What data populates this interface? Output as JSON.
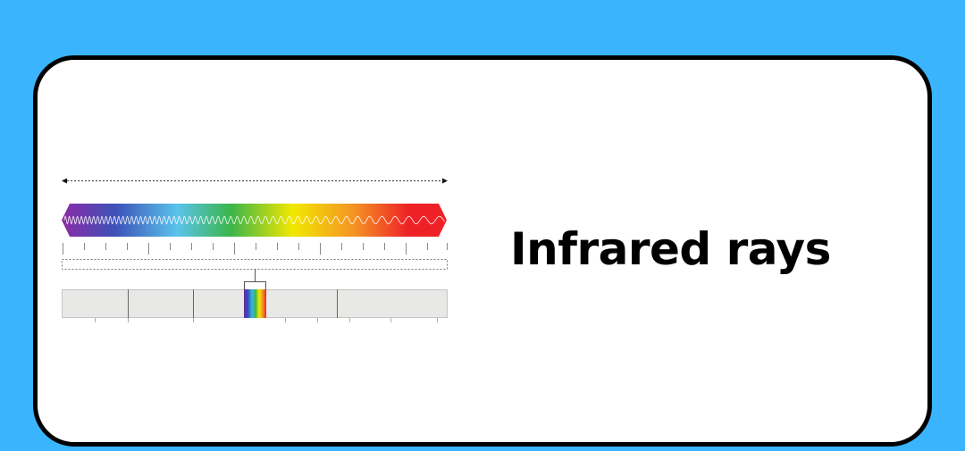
{
  "heading": "Infrared rays",
  "colors": {
    "background": "#3bb4fe",
    "card": "#ffffff",
    "card_border": "#000000",
    "scale_segment": "#e8e8e6",
    "spectrum_stops": [
      "#8b2ba6",
      "#3d52b8",
      "#5ac3ec",
      "#3cb54a",
      "#f2e800",
      "#f49324",
      "#ee2226",
      "#ee2226"
    ]
  },
  "icons": {
    "range_arrow": "double-headed-arrow-icon",
    "wave": "sine-wave-icon"
  }
}
